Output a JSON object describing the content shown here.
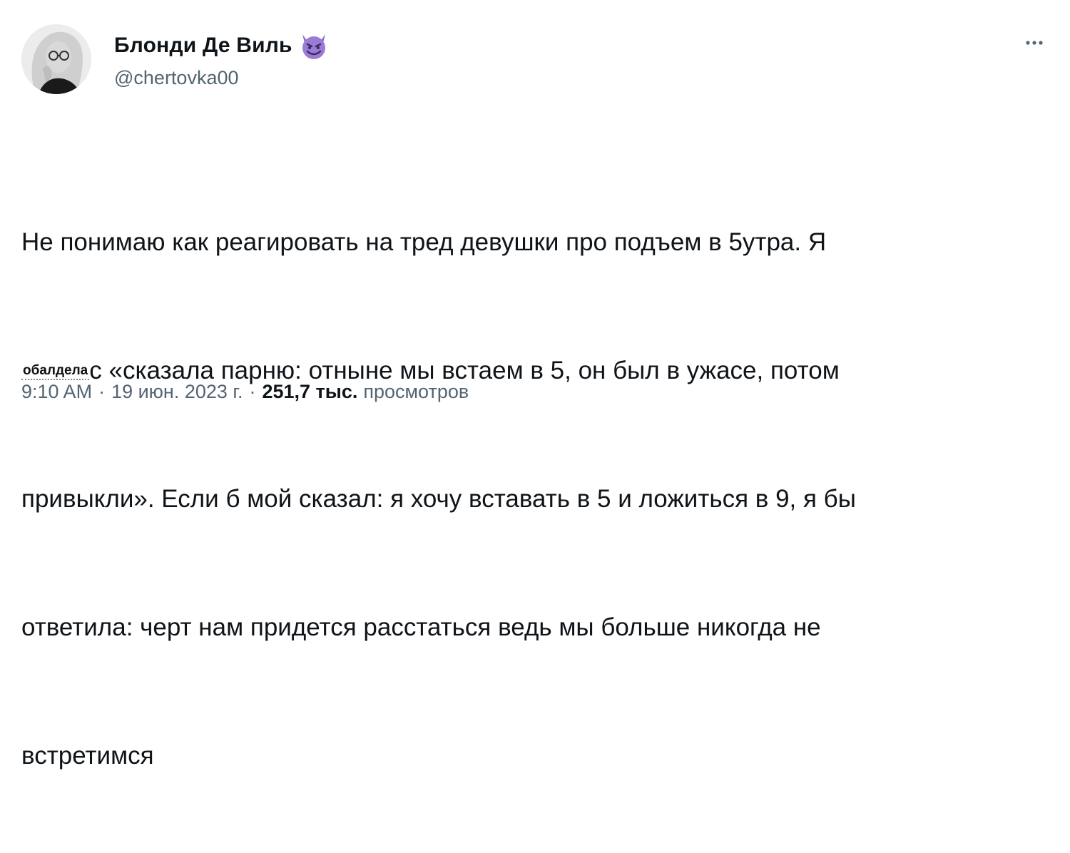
{
  "author": {
    "display_name": "Блонди Де Виль",
    "handle": "@chertovka00",
    "badge_emoji": "smiling-devil-emoji"
  },
  "menu": {
    "more_icon": "more-horizontal-icon"
  },
  "tweet": {
    "lines": [
      "Не понимаю как реагировать на тред девушки про подъем в 5утра. Я",
      "с «сказала парню: отныне мы встаем в 5, он был в ужасе, потом",
      "привыкли». Если б мой сказал: я хочу вставать в 5 и ложиться в 9, я бы",
      "ответила: черт нам придется расстаться ведь мы больше никогда не",
      "встретимся"
    ],
    "sticker_text": "обалдела"
  },
  "meta": {
    "time": "9:10 AM",
    "separator": "·",
    "date": "19 июн. 2023 г.",
    "views_count": "251,7 тыс.",
    "views_label": "просмотров"
  },
  "colors": {
    "text_primary": "#0f1419",
    "text_secondary": "#536471",
    "emoji_purple": "#8d6bc9"
  }
}
